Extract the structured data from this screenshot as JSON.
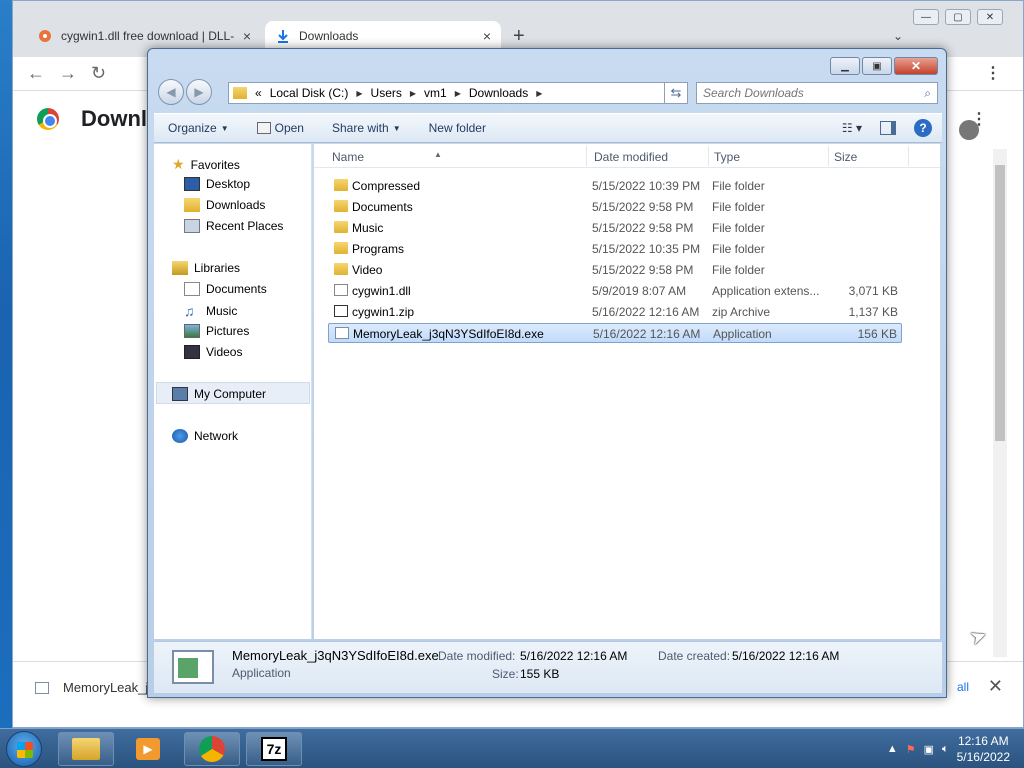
{
  "browser": {
    "tabs": [
      {
        "title": "cygwin1.dll free download | DLL-"
      },
      {
        "title": "Downloads"
      }
    ],
    "new_tab_label": "+",
    "page_title": "Downlo",
    "shelf": {
      "item_name": "MemoryLeak_j",
      "show_all": "all",
      "close": "✕"
    }
  },
  "explorer": {
    "address": {
      "prefix": "«",
      "segments": [
        "Local Disk (C:)",
        "Users",
        "vm1",
        "Downloads"
      ]
    },
    "search_placeholder": "Search Downloads",
    "commands": {
      "organize": "Organize",
      "open": "Open",
      "share_with": "Share with",
      "new_folder": "New folder"
    },
    "nav": {
      "favorites": "Favorites",
      "desktop": "Desktop",
      "downloads": "Downloads",
      "recent_places": "Recent Places",
      "libraries": "Libraries",
      "documents": "Documents",
      "music": "Music",
      "pictures": "Pictures",
      "videos": "Videos",
      "my_computer": "My Computer",
      "network": "Network"
    },
    "columns": {
      "name": "Name",
      "date_modified": "Date modified",
      "type": "Type",
      "size": "Size"
    },
    "files": [
      {
        "name": "Compressed",
        "date": "5/15/2022 10:39 PM",
        "type": "File folder",
        "size": ""
      },
      {
        "name": "Documents",
        "date": "5/15/2022 9:58 PM",
        "type": "File folder",
        "size": ""
      },
      {
        "name": "Music",
        "date": "5/15/2022 9:58 PM",
        "type": "File folder",
        "size": ""
      },
      {
        "name": "Programs",
        "date": "5/15/2022 10:35 PM",
        "type": "File folder",
        "size": ""
      },
      {
        "name": "Video",
        "date": "5/15/2022 9:58 PM",
        "type": "File folder",
        "size": ""
      },
      {
        "name": "cygwin1.dll",
        "date": "5/9/2019 8:07 AM",
        "type": "Application extens...",
        "size": "3,071 KB"
      },
      {
        "name": "cygwin1.zip",
        "date": "5/16/2022 12:16 AM",
        "type": "zip Archive",
        "size": "1,137 KB"
      },
      {
        "name": "MemoryLeak_j3qN3YSdIfoEI8d.exe",
        "date": "5/16/2022 12:16 AM",
        "type": "Application",
        "size": "156 KB"
      }
    ],
    "details": {
      "name": "MemoryLeak_j3qN3YSdIfoEI8d.exe",
      "type": "Application",
      "date_modified_label": "Date modified:",
      "date_modified": "5/16/2022 12:16 AM",
      "date_created_label": "Date created:",
      "date_created": "5/16/2022 12:16 AM",
      "size_label": "Size:",
      "size": "155 KB"
    }
  },
  "taskbar": {
    "time": "12:16 AM",
    "date": "5/16/2022",
    "sevenzip_label": "7z"
  },
  "colors": {
    "selection": "#c1dbfc",
    "accent": "#1a73e8",
    "taskbar": "#2b537f"
  }
}
